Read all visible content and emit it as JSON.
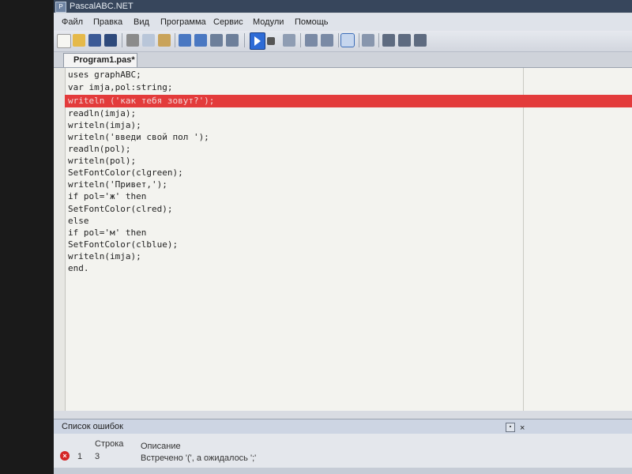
{
  "window": {
    "title": "PascalABC.NET",
    "icon": "app-icon"
  },
  "menu": [
    "Файл",
    "Правка",
    "Вид",
    "Программа",
    "Сервис",
    "Модули",
    "Помощь"
  ],
  "tab": {
    "label": "Program1.pas*"
  },
  "code": {
    "lines": [
      "uses graphABC;",
      "var imja,pol:string;",
      "writeln ('как тебя зовут?');",
      "readln(imja);",
      "writeln(imja);",
      "writeln('введи свой пол ');",
      "readln(pol);",
      "writeln(pol);",
      "SetFontColor(clgreen);",
      "writeln('Привет,');",
      "if pol='ж' then",
      "SetFontColor(clred);",
      "else",
      "if pol='м' then",
      "SetFontColor(clblue);",
      "writeln(imja);",
      "end."
    ],
    "error_line": 3
  },
  "error_panel": {
    "title": "Список ошибок",
    "columns": {
      "line": "Строка",
      "description": "Описание"
    },
    "rows": [
      {
        "index": "1",
        "line": "3",
        "description": "Встречено '(', а ожидалось ';'"
      }
    ]
  },
  "colors": {
    "error_highlight": "#e33b3b",
    "string": "#1a3fbf",
    "titlebar": "#37465c"
  }
}
